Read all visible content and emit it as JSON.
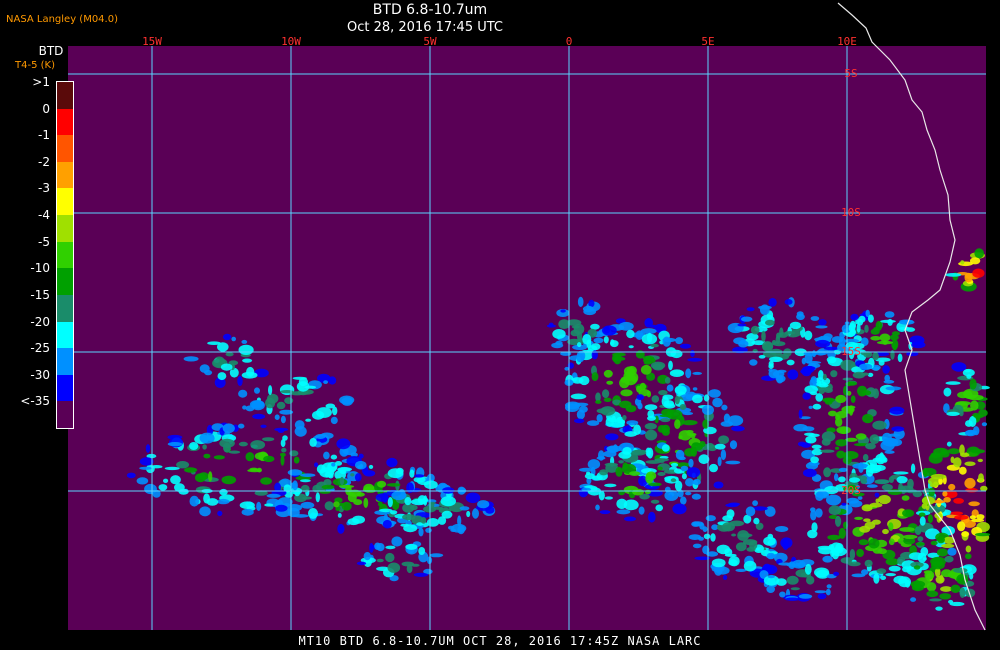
{
  "header": {
    "credit": "NASA Langley (M04.0)",
    "title": "BTD 6.8-10.7um",
    "timestamp": "Oct 28, 2016 17:45 UTC"
  },
  "legend": {
    "title": "BTD",
    "units": "T4-5 (K)",
    "bins": [
      {
        "label": ">1",
        "color": "#5a0a0a"
      },
      {
        "label": "0",
        "color": "#ff0000"
      },
      {
        "label": "-1",
        "color": "#ff5500"
      },
      {
        "label": "-2",
        "color": "#ffa000"
      },
      {
        "label": "-3",
        "color": "#ffff00"
      },
      {
        "label": "-4",
        "color": "#a0e000"
      },
      {
        "label": "-5",
        "color": "#30d000"
      },
      {
        "label": "-10",
        "color": "#00a000"
      },
      {
        "label": "-15",
        "color": "#1a8c6a"
      },
      {
        "label": "-20",
        "color": "#00ffff"
      },
      {
        "label": "-25",
        "color": "#0090ff"
      },
      {
        "label": "-30",
        "color": "#0000ff"
      },
      {
        "label": "<-35",
        "color": "#5a0056"
      }
    ]
  },
  "map": {
    "background_color": "#5a0056",
    "grid_color": "#5ad5ff",
    "longitude_labels": [
      "15W",
      "10W",
      "5W",
      "0",
      "5E",
      "10E"
    ],
    "latitude_labels": [
      "5S",
      "10S",
      "15S",
      "20S"
    ],
    "label_color": "#ff3030"
  },
  "footer": {
    "text": "MT10   BTD 6.8-10.7UM    OCT 28, 2016 17:45Z    NASA LARC"
  }
}
